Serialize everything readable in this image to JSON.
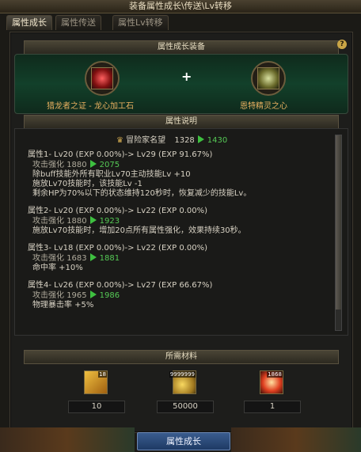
{
  "window": {
    "title": "装备属性成长\\传送\\Lv转移"
  },
  "tabs": [
    {
      "label": "属性成长"
    },
    {
      "label": "属性传送"
    },
    {
      "label": "属性Lv转移"
    }
  ],
  "help_icon": "?",
  "equip_section": {
    "title": "属性成长装备",
    "left_item": "猎龙者之证 - 龙心加工石",
    "right_item": "恩特精灵之心",
    "plus": "+"
  },
  "desc_section": {
    "title": "属性说明",
    "adventure": {
      "label": "冒险家名望",
      "from": "1328",
      "to": "1430"
    },
    "attributes": [
      {
        "header": "属性1- Lv20 (EXP 0.00%)-> Lv29 (EXP 91.67%)",
        "atk_label": "攻击强化",
        "atk_from": "1880",
        "atk_to": "2075",
        "extra": [
          "除buff技能外所有职业Lv70主动技能Lv +10",
          "施放Lv70技能时，该技能Lv -1",
          "剩余HP为70%以下的状态维持120秒时，恢复减少的技能Lv。"
        ]
      },
      {
        "header": "属性2- Lv20 (EXP 0.00%)-> Lv22 (EXP 0.00%)",
        "atk_label": "攻击强化",
        "atk_from": "1880",
        "atk_to": "1923",
        "extra": [
          "施放Lv70技能时，增加20点所有属性强化，效果持续30秒。"
        ]
      },
      {
        "header": "属性3- Lv18 (EXP 0.00%)-> Lv22 (EXP 0.00%)",
        "atk_label": "攻击强化",
        "atk_from": "1683",
        "atk_to": "1881",
        "extra": [
          "命中率 +10%"
        ]
      },
      {
        "header": "属性4- Lv26 (EXP 0.00%)-> Lv27 (EXP 66.67%)",
        "atk_label": "攻击强化",
        "atk_from": "1965",
        "atk_to": "1986",
        "extra": [
          "物理暴击率 +5%"
        ]
      }
    ]
  },
  "materials_section": {
    "title": "所需材料",
    "items": [
      {
        "count": "18",
        "required": "10",
        "icon": "ticket-icon"
      },
      {
        "count": "9999999",
        "required": "50000",
        "icon": "gold-coins-icon"
      },
      {
        "count": "1868",
        "required": "1",
        "icon": "burst-orb-icon"
      }
    ]
  },
  "action_button": {
    "label": "属性成长"
  }
}
